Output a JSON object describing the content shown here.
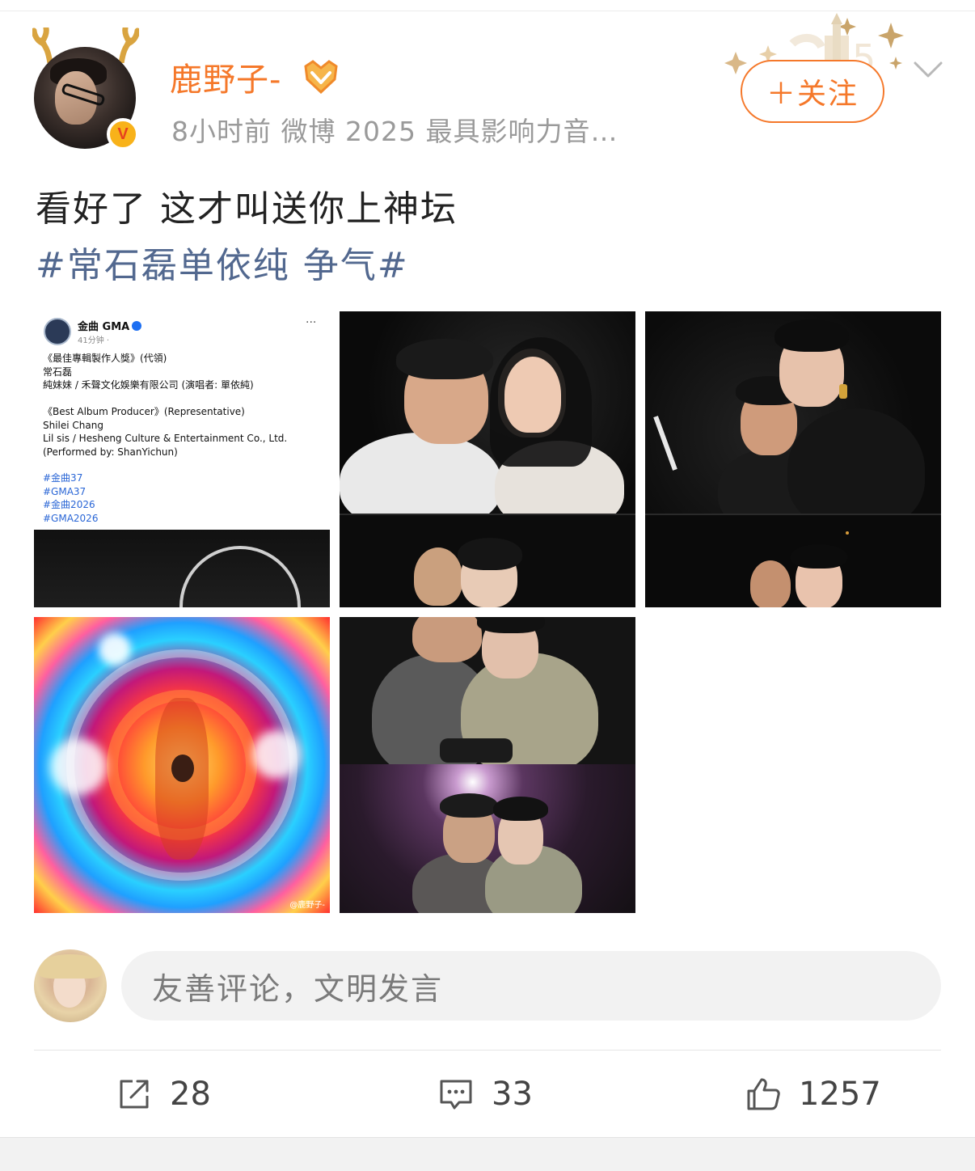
{
  "post": {
    "username": "鹿野子-",
    "meta": "8小时前  微博 2025 最具影响力音…",
    "follow_label": "＋关注",
    "text": "看好了 这才叫送你上神坛",
    "topic": "#常石磊单依纯 争气#"
  },
  "images": {
    "gma_card": {
      "account": "金曲 GMA",
      "time": "41分钟 · ",
      "more": "···",
      "lines": "《最佳專輯製作人獎》(代領)\n常石磊\n純妹妹 / 禾聲文化娛樂有限公司 (演唱者: 單依純)\n\n《Best Album Producer》(Representative)\nShilei Chang\nLil sis / Hesheng Culture & Entertainment Co., Ltd.\n(Performed by: ShanYichun)",
      "tags": "#金曲37\n#GMA37\n#金曲2026\n#GMA2026"
    },
    "watermark": "@鹿野子-"
  },
  "comment_bar": {
    "placeholder": "友善评论，文明发言"
  },
  "actions": {
    "repost_count": "28",
    "comment_count": "33",
    "like_count": "1257"
  },
  "colors": {
    "accent": "#f5782a",
    "topic": "#52688f",
    "meta": "#9a9a9a"
  },
  "icons": {
    "repost": "share-square-icon",
    "comment": "comment-bubble-icon",
    "like": "thumbs-up-icon",
    "more": "chevron-down-icon",
    "verified": "verified-v-icon",
    "medal": "fan-medal-icon"
  }
}
